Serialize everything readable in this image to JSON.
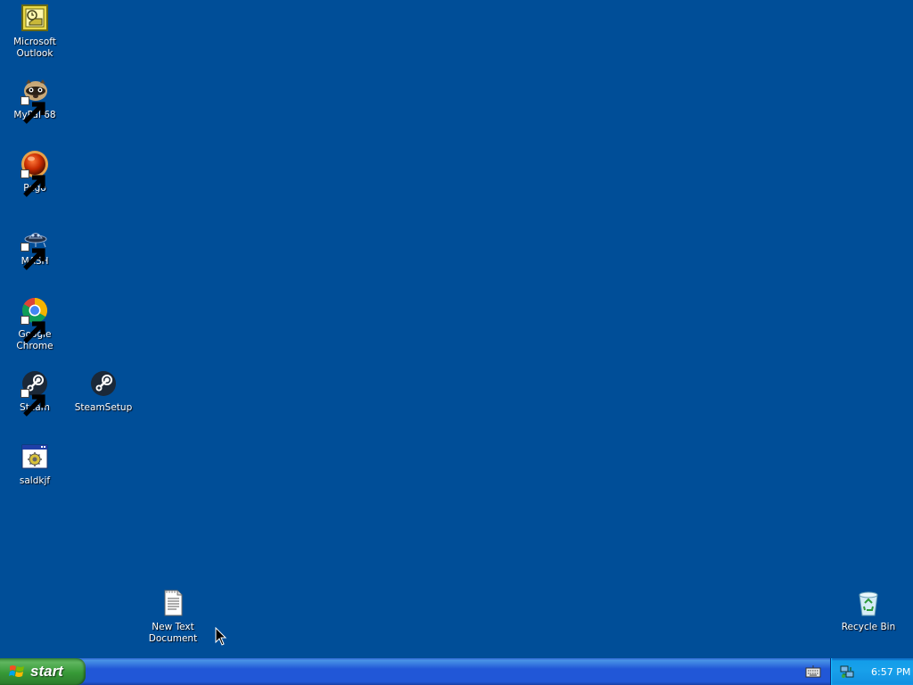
{
  "desktop_icons": [
    {
      "label": "Microsoft\nOutlook",
      "icon": "outlook-icon",
      "shortcut": false
    },
    {
      "label": "MyPal 68",
      "icon": "mypal-icon",
      "shortcut": true
    },
    {
      "label": "Pego",
      "icon": "pego-icon",
      "shortcut": true
    },
    {
      "label": "MASH",
      "icon": "mash-icon",
      "shortcut": true
    },
    {
      "label": "Google Chrome",
      "icon": "chrome-icon",
      "shortcut": true
    },
    {
      "label": "Steam",
      "icon": "steam-icon",
      "shortcut": true
    },
    {
      "label": "SteamSetup",
      "icon": "steam-setup-icon",
      "shortcut": false
    },
    {
      "label": "saldkjf",
      "icon": "application-icon",
      "shortcut": false
    },
    {
      "label": "New Text\nDocument",
      "icon": "text-document-icon",
      "shortcut": false
    },
    {
      "label": "Recycle Bin",
      "icon": "recycle-bin-icon",
      "shortcut": false
    }
  ],
  "taskbar": {
    "start_label": "start",
    "clock": "6:57 PM"
  },
  "colors": {
    "desktop": "#004e98",
    "taskbar": "#2157d7",
    "start_button": "#379937",
    "tray": "#18a0ea"
  }
}
